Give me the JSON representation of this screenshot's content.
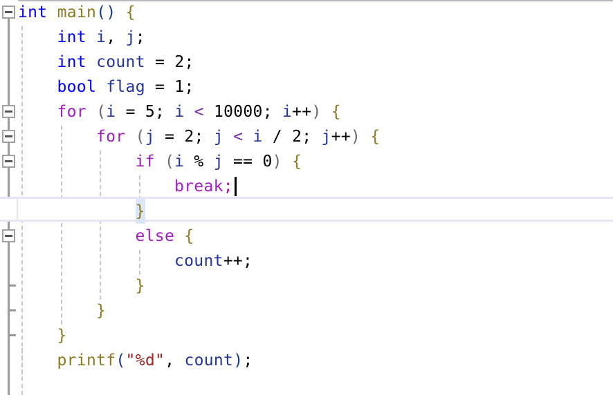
{
  "editor": {
    "language": "c",
    "line_height": 36,
    "font_size": 23,
    "background": "#ffffff",
    "current_line_number": 8,
    "current_line_highlight_color": "#e6e6f2",
    "caret": {
      "line": 8,
      "column": 18,
      "color": "#000000"
    }
  },
  "colors": {
    "keyword_type": "#0000ff",
    "keyword_control": "#a020c0",
    "function_name": "#8a7a22",
    "variable": "#23359b",
    "brace": "#8a7a22",
    "paren": "#1a3a8a",
    "string": "#a52020",
    "number": "#000000",
    "operator": "#000000",
    "gutter_line": "#9a9a9a",
    "fold_box_border": "#a0a0a4",
    "indent_guide": "#c6c6c6",
    "matched_brace_background": "#dbe6f7"
  },
  "gutter": {
    "fold_boxes": [
      {
        "line": 1,
        "state": "expanded",
        "glyph": "minus"
      },
      {
        "line": 5,
        "state": "expanded",
        "glyph": "minus"
      },
      {
        "line": 6,
        "state": "expanded",
        "glyph": "minus"
      },
      {
        "line": 7,
        "state": "expanded",
        "glyph": "minus"
      },
      {
        "line": 10,
        "state": "expanded",
        "glyph": "minus"
      }
    ],
    "end_ticks": [
      12,
      13,
      14
    ]
  },
  "code": {
    "lines": [
      {
        "n": 1,
        "indent": 0,
        "text": "int main() {",
        "tokens": [
          {
            "s": "int",
            "c": "t-kw"
          },
          {
            "s": " ",
            "c": "t-plain"
          },
          {
            "s": "main",
            "c": "t-fn"
          },
          {
            "s": "()",
            "c": "t-paren"
          },
          {
            "s": " ",
            "c": "t-plain"
          },
          {
            "s": "{",
            "c": "t-brace"
          }
        ]
      },
      {
        "n": 2,
        "indent": 1,
        "text": "int i, j;",
        "tokens": [
          {
            "s": "int",
            "c": "t-kw"
          },
          {
            "s": " ",
            "c": "t-plain"
          },
          {
            "s": "i",
            "c": "t-var"
          },
          {
            "s": ", ",
            "c": "t-plain"
          },
          {
            "s": "j",
            "c": "t-var"
          },
          {
            "s": ";",
            "c": "t-plain"
          }
        ]
      },
      {
        "n": 3,
        "indent": 1,
        "text": "int count = 2;",
        "tokens": [
          {
            "s": "int",
            "c": "t-kw"
          },
          {
            "s": " ",
            "c": "t-plain"
          },
          {
            "s": "count",
            "c": "t-var"
          },
          {
            "s": " = ",
            "c": "t-op"
          },
          {
            "s": "2",
            "c": "t-num"
          },
          {
            "s": ";",
            "c": "t-plain"
          }
        ]
      },
      {
        "n": 4,
        "indent": 1,
        "text": "bool flag = 1;",
        "tokens": [
          {
            "s": "bool",
            "c": "t-kw"
          },
          {
            "s": " ",
            "c": "t-plain"
          },
          {
            "s": "flag",
            "c": "t-var"
          },
          {
            "s": " = ",
            "c": "t-op"
          },
          {
            "s": "1",
            "c": "t-num"
          },
          {
            "s": ";",
            "c": "t-plain"
          }
        ]
      },
      {
        "n": 5,
        "indent": 1,
        "text": "for (i = 5; i < 10000; i++) {",
        "tokens": [
          {
            "s": "for",
            "c": "t-ctrl"
          },
          {
            "s": " ",
            "c": "t-plain"
          },
          {
            "s": "(",
            "c": "t-paren-g"
          },
          {
            "s": "i",
            "c": "t-var"
          },
          {
            "s": " = ",
            "c": "t-op"
          },
          {
            "s": "5",
            "c": "t-num"
          },
          {
            "s": "; ",
            "c": "t-plain"
          },
          {
            "s": "i",
            "c": "t-var"
          },
          {
            "s": " ",
            "c": "t-plain"
          },
          {
            "s": "<",
            "c": "t-op-p"
          },
          {
            "s": " ",
            "c": "t-plain"
          },
          {
            "s": "10000",
            "c": "t-num"
          },
          {
            "s": "; ",
            "c": "t-plain"
          },
          {
            "s": "i",
            "c": "t-var"
          },
          {
            "s": "++",
            "c": "t-op"
          },
          {
            "s": ")",
            "c": "t-paren-g"
          },
          {
            "s": " ",
            "c": "t-plain"
          },
          {
            "s": "{",
            "c": "t-brace"
          }
        ]
      },
      {
        "n": 6,
        "indent": 2,
        "text": "for (j = 2; j < i / 2; j++) {",
        "tokens": [
          {
            "s": "for",
            "c": "t-ctrl"
          },
          {
            "s": " ",
            "c": "t-plain"
          },
          {
            "s": "(",
            "c": "t-paren-g"
          },
          {
            "s": "j",
            "c": "t-var"
          },
          {
            "s": " = ",
            "c": "t-op"
          },
          {
            "s": "2",
            "c": "t-num"
          },
          {
            "s": "; ",
            "c": "t-plain"
          },
          {
            "s": "j",
            "c": "t-var"
          },
          {
            "s": " ",
            "c": "t-plain"
          },
          {
            "s": "<",
            "c": "t-op-p"
          },
          {
            "s": " ",
            "c": "t-plain"
          },
          {
            "s": "i",
            "c": "t-var"
          },
          {
            "s": " / ",
            "c": "t-op"
          },
          {
            "s": "2",
            "c": "t-num"
          },
          {
            "s": "; ",
            "c": "t-plain"
          },
          {
            "s": "j",
            "c": "t-var"
          },
          {
            "s": "++",
            "c": "t-op"
          },
          {
            "s": ")",
            "c": "t-paren-g"
          },
          {
            "s": " ",
            "c": "t-plain"
          },
          {
            "s": "{",
            "c": "t-brace"
          }
        ]
      },
      {
        "n": 7,
        "indent": 3,
        "text": "if (i % j == 0) {",
        "tokens": [
          {
            "s": "if",
            "c": "t-ctrl"
          },
          {
            "s": " ",
            "c": "t-plain"
          },
          {
            "s": "(",
            "c": "t-paren-g"
          },
          {
            "s": "i",
            "c": "t-var"
          },
          {
            "s": " % ",
            "c": "t-op"
          },
          {
            "s": "j",
            "c": "t-var"
          },
          {
            "s": " == ",
            "c": "t-op"
          },
          {
            "s": "0",
            "c": "t-num"
          },
          {
            "s": ")",
            "c": "t-paren-g"
          },
          {
            "s": " ",
            "c": "t-plain"
          },
          {
            "s": "{",
            "c": "t-brace"
          }
        ]
      },
      {
        "n": 8,
        "indent": 4,
        "text": "break;",
        "tokens": [
          {
            "s": "break",
            "c": "t-ctrl"
          },
          {
            "s": ";",
            "c": "t-semi"
          }
        ]
      },
      {
        "n": 9,
        "indent": 3,
        "text": "}",
        "current": true,
        "tokens": [
          {
            "s": "}",
            "c": "t-brace-m"
          }
        ]
      },
      {
        "n": 10,
        "indent": 3,
        "text": "else {",
        "tokens": [
          {
            "s": "else",
            "c": "t-ctrl"
          },
          {
            "s": " ",
            "c": "t-plain"
          },
          {
            "s": "{",
            "c": "t-brace"
          }
        ]
      },
      {
        "n": 11,
        "indent": 4,
        "text": "count++;",
        "tokens": [
          {
            "s": "count",
            "c": "t-var"
          },
          {
            "s": "++",
            "c": "t-op"
          },
          {
            "s": ";",
            "c": "t-plain"
          }
        ]
      },
      {
        "n": 12,
        "indent": 3,
        "text": "}",
        "tokens": [
          {
            "s": "}",
            "c": "t-brace"
          }
        ]
      },
      {
        "n": 13,
        "indent": 2,
        "text": "}",
        "tokens": [
          {
            "s": "}",
            "c": "t-brace"
          }
        ]
      },
      {
        "n": 14,
        "indent": 1,
        "text": "}",
        "tokens": [
          {
            "s": "}",
            "c": "t-brace"
          }
        ]
      },
      {
        "n": 15,
        "indent": 1,
        "text": "printf(\"%d\", count);",
        "tokens": [
          {
            "s": "printf",
            "c": "t-fn"
          },
          {
            "s": "(",
            "c": "t-paren"
          },
          {
            "s": "\"%d\"",
            "c": "t-str"
          },
          {
            "s": ", ",
            "c": "t-plain"
          },
          {
            "s": "count",
            "c": "t-var"
          },
          {
            "s": ")",
            "c": "t-paren"
          },
          {
            "s": ";",
            "c": "t-plain"
          }
        ]
      }
    ]
  }
}
